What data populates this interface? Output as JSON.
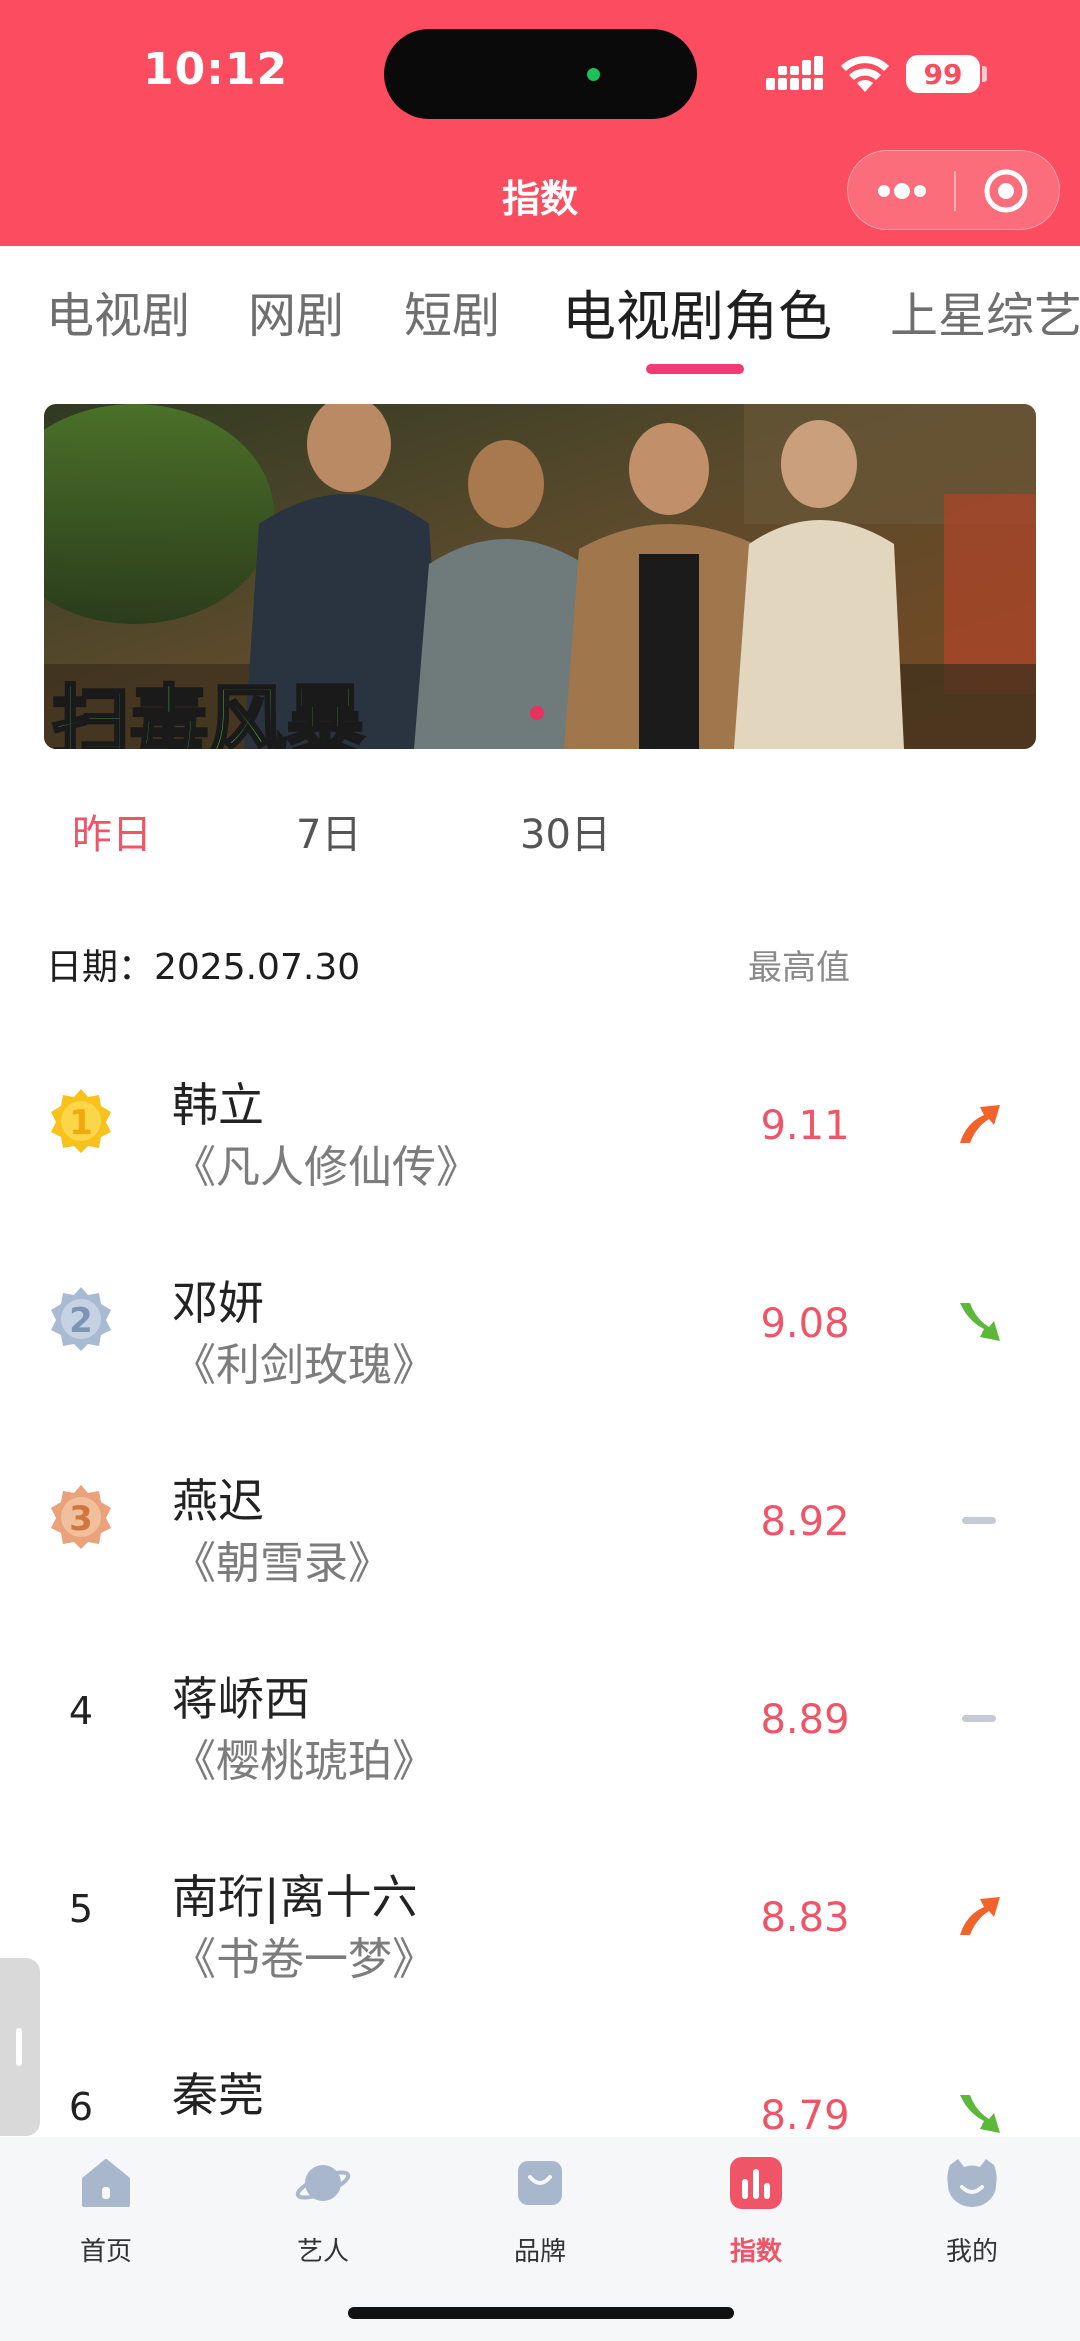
{
  "status_bar": {
    "time": "10:12",
    "battery": "99",
    "signal_icon": "cellular-signal-icon",
    "wifi_icon": "wifi-icon"
  },
  "nav": {
    "title": "指数",
    "more_icon": "more-dots-icon",
    "close_icon": "target-close-icon"
  },
  "tabs": [
    {
      "label": "电视剧",
      "active": false
    },
    {
      "label": "网剧",
      "active": false
    },
    {
      "label": "短剧",
      "active": false
    },
    {
      "label": "电视剧角色",
      "active": true
    },
    {
      "label": "上星综艺",
      "active": false
    }
  ],
  "banner": {
    "caption": "扫毒风暴"
  },
  "periods": [
    {
      "label": "昨日",
      "active": true
    },
    {
      "label": "7日",
      "active": false
    },
    {
      "label": "30日",
      "active": false
    }
  ],
  "list_header": {
    "date_label": "日期：2025.07.30",
    "max_label": "最高值"
  },
  "ranking": [
    {
      "rank": "1",
      "name": "韩立",
      "drama": "《凡人修仙传》",
      "score": "9.11",
      "trend": "up",
      "medal": "gold"
    },
    {
      "rank": "2",
      "name": "邓妍",
      "drama": "《利剑玫瑰》",
      "score": "9.08",
      "trend": "down",
      "medal": "silver"
    },
    {
      "rank": "3",
      "name": "燕迟",
      "drama": "《朝雪录》",
      "score": "8.92",
      "trend": "flat",
      "medal": "bronze"
    },
    {
      "rank": "4",
      "name": "蒋峤西",
      "drama": "《樱桃琥珀》",
      "score": "8.89",
      "trend": "flat",
      "medal": ""
    },
    {
      "rank": "5",
      "name": "南珩|离十六",
      "drama": "《书卷一梦》",
      "score": "8.83",
      "trend": "up",
      "medal": ""
    },
    {
      "rank": "6",
      "name": "秦莞",
      "drama": "",
      "score": "8.79",
      "trend": "down",
      "medal": ""
    }
  ],
  "tabbar": [
    {
      "label": "首页",
      "icon": "home-icon",
      "active": false
    },
    {
      "label": "艺人",
      "icon": "planet-icon",
      "active": false
    },
    {
      "label": "品牌",
      "icon": "shopping-bag-icon",
      "active": false
    },
    {
      "label": "指数",
      "icon": "bar-chart-icon",
      "active": true
    },
    {
      "label": "我的",
      "icon": "profile-face-icon",
      "active": false
    }
  ],
  "colors": {
    "header": "#fb4d5f",
    "accent": "#f05467",
    "tab_underline": "#f23a74",
    "trend_up": "#f2622b",
    "trend_down": "#5cb83a",
    "trend_flat": "#c5cbd6"
  }
}
